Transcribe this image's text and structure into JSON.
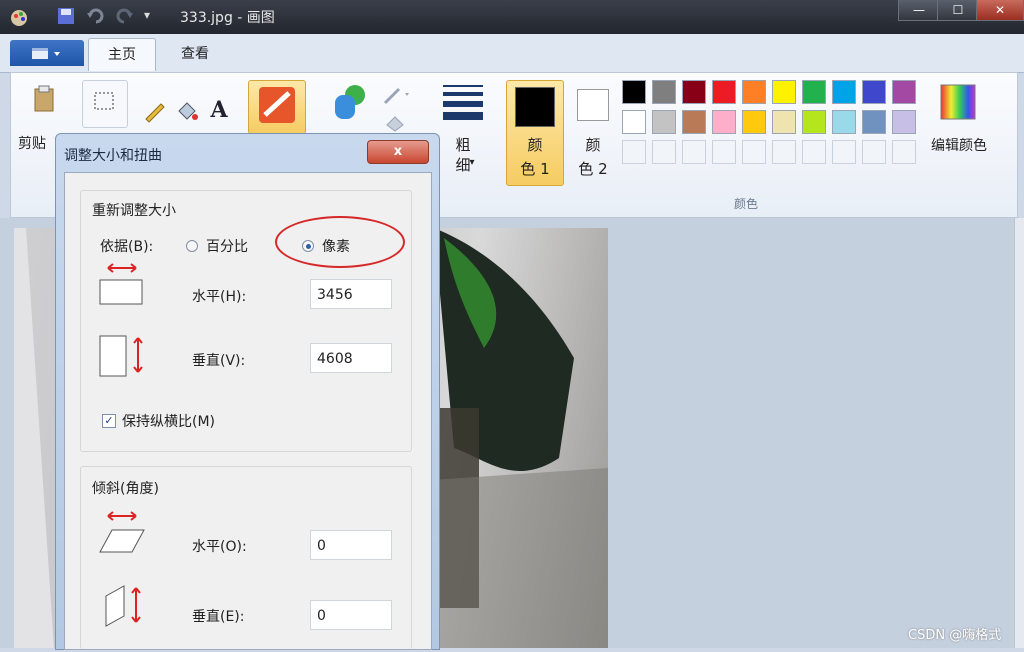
{
  "window": {
    "title": "333.jpg - 画图",
    "min": "—",
    "max": "☐",
    "close": "✕"
  },
  "tabs": [
    {
      "label": "主页"
    },
    {
      "label": "查看"
    }
  ],
  "ribbon": {
    "clipboard_label": "剪贴",
    "size_label": "粗\n细",
    "size_arrow": "▾",
    "color1_label": "颜\n色 1",
    "color2_label": "颜\n色 2",
    "edit_colors_label": "编辑颜色",
    "colors_group_label": "颜色",
    "palette_row1": [
      "#000000",
      "#7f7f7f",
      "#880015",
      "#ed1c24",
      "#ff7f27",
      "#fff200",
      "#22b14c",
      "#00a2e8",
      "#3f48cc",
      "#a349a4"
    ],
    "palette_row2": [
      "#ffffff",
      "#c3c3c3",
      "#b97a57",
      "#ffaec9",
      "#ffc90e",
      "#efe4b0",
      "#b5e61d",
      "#99d9ea",
      "#7092be",
      "#c8bfe7"
    ]
  },
  "dialog": {
    "title": "调整大小和扭曲",
    "close": "x",
    "resize_section": "重新调整大小",
    "basis_label": "依据(B):",
    "opt_percent": "百分比",
    "opt_pixels": "像素",
    "h_label": "水平(H):",
    "h_value": "3456",
    "v_label": "垂直(V):",
    "v_value": "4608",
    "keep_ratio": "保持纵横比(M)",
    "skew_section": "倾斜(角度)",
    "skew_h_label": "水平(O):",
    "skew_h_value": "0",
    "skew_v_label": "垂直(E):",
    "skew_v_value": "0"
  },
  "watermark": "CSDN @嗨格式"
}
